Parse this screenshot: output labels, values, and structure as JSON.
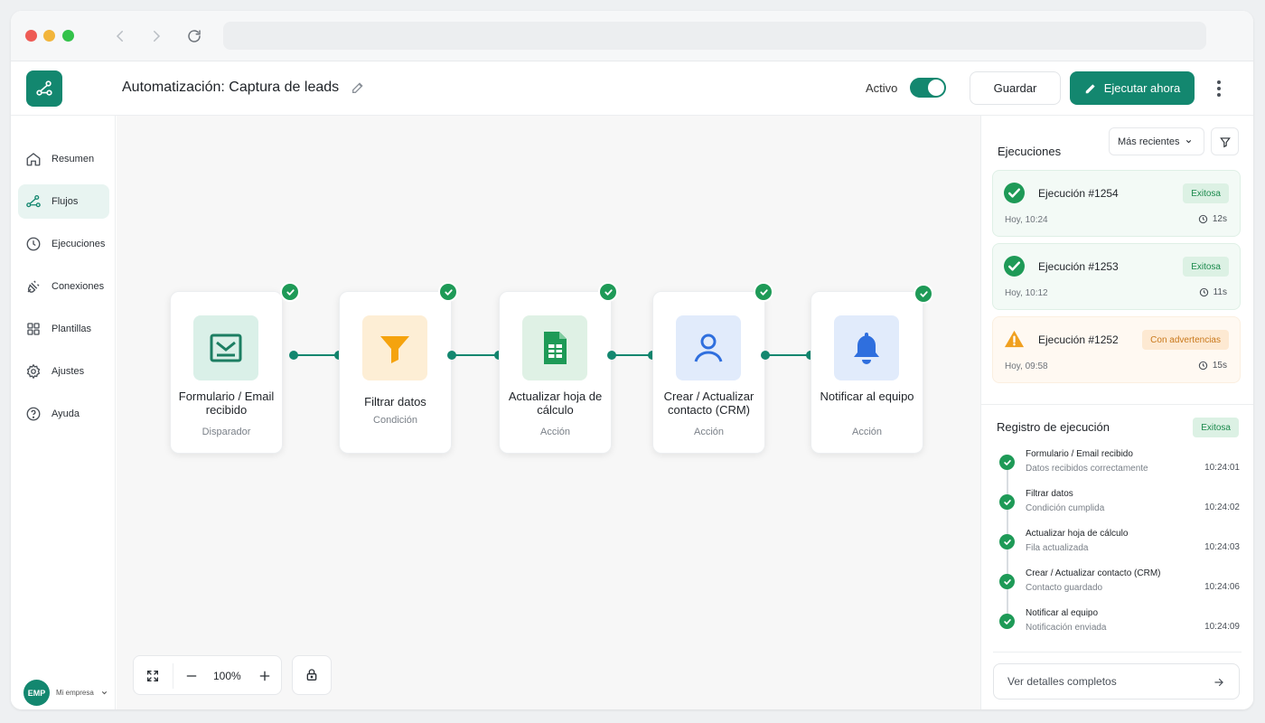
{
  "header": {
    "title": "Automatización: Captura de leads",
    "active_label": "Activo",
    "active_on": true,
    "save_label": "Guardar",
    "run_label": "Ejecutar ahora"
  },
  "sidebar": {
    "items": [
      {
        "label": "Resumen",
        "icon": "home-icon"
      },
      {
        "label": "Flujos",
        "icon": "flow-icon",
        "active": true
      },
      {
        "label": "Ejecuciones",
        "icon": "clock-icon"
      },
      {
        "label": "Conexiones",
        "icon": "plug-icon"
      },
      {
        "label": "Plantillas",
        "icon": "grid-icon"
      },
      {
        "label": "Ajustes",
        "icon": "gear-icon"
      },
      {
        "label": "Ayuda",
        "icon": "help-icon"
      }
    ],
    "account": {
      "avatar": "EMP",
      "org": "Mi empresa"
    }
  },
  "canvas": {
    "nodes": [
      {
        "title": "Formulario / Email recibido",
        "type": "Disparador",
        "icon": "form-email-icon"
      },
      {
        "title": "Filtrar datos",
        "type": "Condición",
        "icon": "funnel-icon"
      },
      {
        "title": "Actualizar hoja de cálculo",
        "type": "Acción",
        "icon": "spreadsheet-icon"
      },
      {
        "title": "Crear / Actualizar contacto (CRM)",
        "type": "Acción",
        "icon": "contact-icon"
      },
      {
        "title": "Notificar al equipo",
        "type": "Acción",
        "icon": "bell-icon"
      }
    ],
    "zoom": "100%"
  },
  "panel": {
    "title": "Ejecuciones",
    "sort_label": "Más recientes",
    "executions": [
      {
        "name": "Ejecución #1254",
        "status": "Exitosa",
        "time": "Hoy, 10:24",
        "duration": "12s"
      },
      {
        "name": "Ejecución #1253",
        "status": "Exitosa",
        "time": "Hoy, 10:12",
        "duration": "11s"
      },
      {
        "name": "Ejecución #1252",
        "status": "Con advertencias",
        "time": "Hoy, 09:58",
        "duration": "15s"
      }
    ],
    "log": {
      "title": "Registro de ejecución",
      "status": "Exitosa",
      "steps": [
        {
          "name": "Formulario / Email recibido",
          "desc": "Datos recibidos correctamente",
          "time": "10:24:01"
        },
        {
          "name": "Filtrar datos",
          "desc": "Condición cumplida",
          "time": "10:24:02"
        },
        {
          "name": "Actualizar hoja de cálculo",
          "desc": "Fila actualizada",
          "time": "10:24:03"
        },
        {
          "name": "Crear / Actualizar contacto (CRM)",
          "desc": "Contacto guardado",
          "time": "10:24:06"
        },
        {
          "name": "Notificar al equipo",
          "desc": "Notificación enviada",
          "time": "10:24:09"
        }
      ]
    },
    "details_label": "Ver detalles completos"
  },
  "colors": {
    "accent": "#13876f",
    "success": "#1e9a57",
    "warning": "#f0a020"
  }
}
